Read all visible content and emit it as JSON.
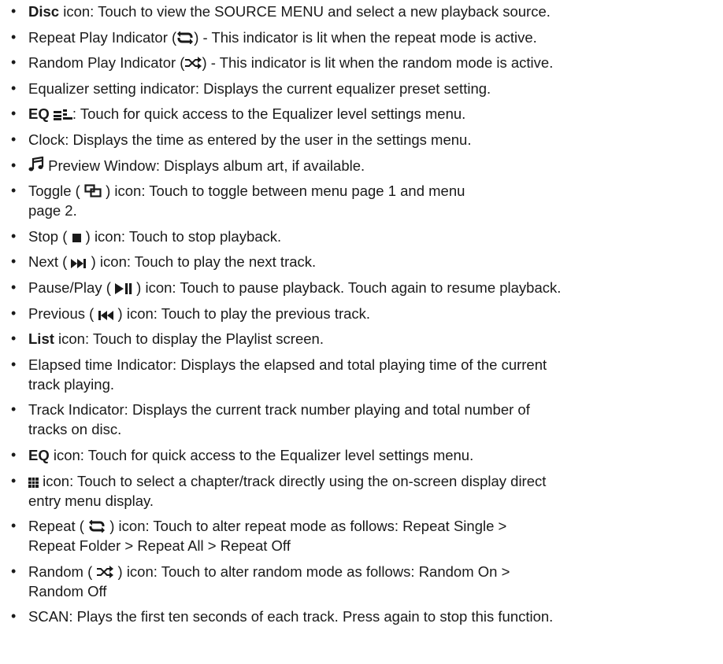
{
  "items": [
    {
      "bold": "Disc",
      "text": " icon: Touch to view the SOURCE MENU and select a new playback source."
    },
    {
      "pre": "Repeat Play Indicator (",
      "icon": "repeat-icon",
      "post": ") - This indicator is lit when the repeat mode is active."
    },
    {
      "pre": "Random Play Indicator (",
      "icon": "shuffle-icon",
      "post": ") - This indicator is lit when the random mode is active."
    },
    {
      "text": "Equalizer setting indicator: Displays the current equalizer preset setting."
    },
    {
      "bold": "EQ",
      "icon": "equalizer-bars-icon",
      "post": ": Touch for quick access to the Equalizer level settings menu."
    },
    {
      "text": "Clock: Displays the time as entered by the user in the settings menu."
    },
    {
      "icon": "music-note-icon",
      "post": " Preview Window: Displays album art, if available."
    },
    {
      "pre": "Toggle ( ",
      "icon": "toggle-icon",
      "post": " ) icon: Touch to toggle between menu page 1 and menu",
      "post2": "page 2."
    },
    {
      "pre": "Stop ( ",
      "icon": "stop-icon",
      "post": " ) icon: Touch to stop playback."
    },
    {
      "pre": "Next ( ",
      "icon": "next-icon",
      "post": " ) icon: Touch to play the next track."
    },
    {
      "pre": "Pause/Play ( ",
      "icon": "play-pause-icon",
      "post": " ) icon: Touch to pause playback. Touch again to resume playback."
    },
    {
      "pre": "Previous ( ",
      "icon": "previous-icon",
      "post": " ) icon: Touch to play the previous track."
    },
    {
      "bold": "List",
      "text": " icon: Touch to display the Playlist screen."
    },
    {
      "text": "Elapsed time Indicator: Displays the elapsed and total playing time of the current",
      "text2": "track playing."
    },
    {
      "text": "Track Indicator: Displays the current track number playing and total number of",
      "text2": "tracks on disc."
    },
    {
      "bold": "EQ",
      "text": " icon: Touch for quick access to the Equalizer level settings menu."
    },
    {
      "icon": "keypad-icon",
      "post": " icon: Touch to select a chapter/track directly using the on-screen display direct",
      "post2": "entry menu display."
    },
    {
      "pre": "Repeat ( ",
      "icon": "repeat-icon",
      "post": " ) icon: Touch to alter repeat mode as follows: Repeat Single >",
      "post2": "Repeat Folder > Repeat All > Repeat Off"
    },
    {
      "pre": "Random ( ",
      "icon": "shuffle-icon",
      "post": " ) icon: Touch to alter random mode as follows: Random On >",
      "post2": "Random Off"
    },
    {
      "text": "SCAN: Plays the first ten seconds of each track. Press again to stop this function."
    }
  ]
}
